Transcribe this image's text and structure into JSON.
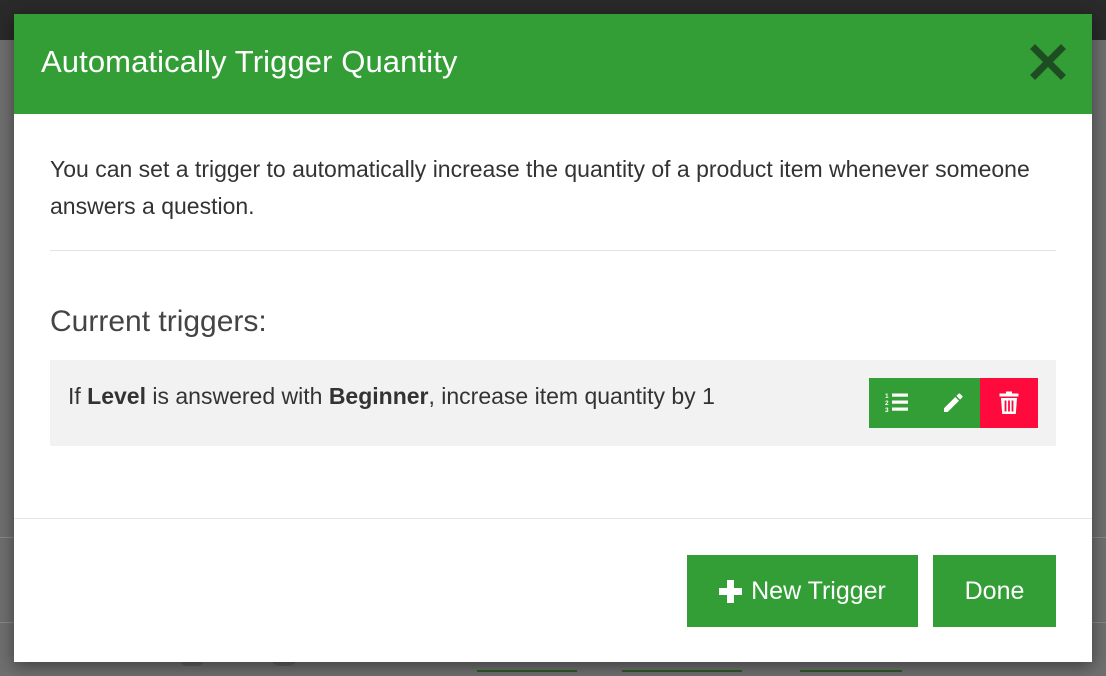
{
  "modal": {
    "title": "Automatically Trigger Quantity",
    "description": "You can set a trigger to automatically increase the quantity of a product item whenever someone answers a question.",
    "section_title": "Current triggers:",
    "triggers": [
      {
        "prefix": "If ",
        "question": "Level",
        "middle": " is answered with ",
        "answer": "Beginner",
        "suffix": ", increase item quantity by 1",
        "actions": [
          "list-icon",
          "pencil-icon",
          "trash-icon"
        ]
      }
    ],
    "new_trigger_label": "New Trigger",
    "done_label": "Done"
  },
  "colors": {
    "accent": "#339e36",
    "danger": "#ff0a3c",
    "close_icon": "#1f4d23"
  }
}
